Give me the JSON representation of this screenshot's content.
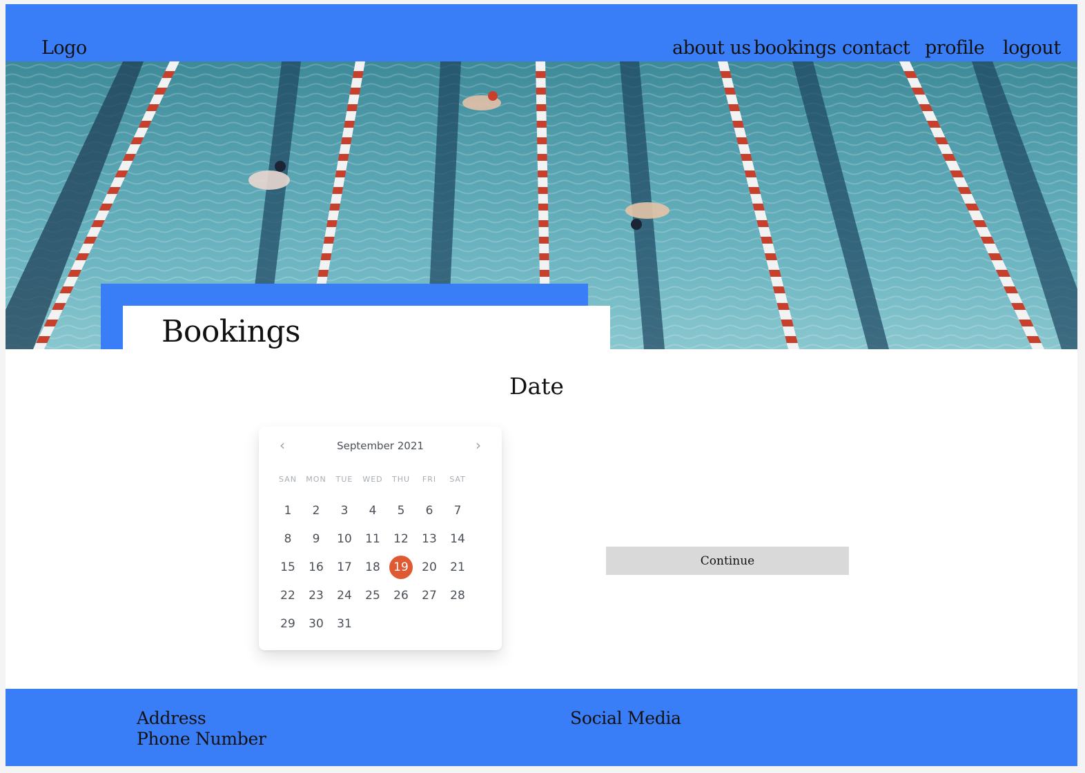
{
  "header": {
    "logo": "Logo",
    "nav": [
      {
        "label": "about us"
      },
      {
        "label": "bookings"
      },
      {
        "label": "contact"
      },
      {
        "label": "profile"
      },
      {
        "label": "logout"
      }
    ]
  },
  "hero": {
    "image": "swimming-pool-lanes"
  },
  "page": {
    "title": "Bookings",
    "section_title": "Date"
  },
  "calendar": {
    "month_label": "September 2021",
    "prev_icon": "chevron-left-icon",
    "next_icon": "chevron-right-icon",
    "weekdays": [
      "SAN",
      "MON",
      "TUE",
      "WED",
      "THU",
      "FRI",
      "SAT"
    ],
    "days": [
      "1",
      "2",
      "3",
      "4",
      "5",
      "6",
      "7",
      "8",
      "9",
      "10",
      "11",
      "12",
      "13",
      "14",
      "15",
      "16",
      "17",
      "18",
      "19",
      "20",
      "21",
      "22",
      "23",
      "24",
      "25",
      "26",
      "27",
      "28",
      "29",
      "30",
      "31"
    ],
    "selected_day": "19",
    "selected_color": "#df5a33"
  },
  "actions": {
    "continue_label": "Continue"
  },
  "footer": {
    "address": "Address",
    "phone": "Phone Number",
    "social": "Social Media"
  },
  "colors": {
    "brand_blue": "#3a7ef7",
    "button_gray": "#d9d9d9"
  }
}
